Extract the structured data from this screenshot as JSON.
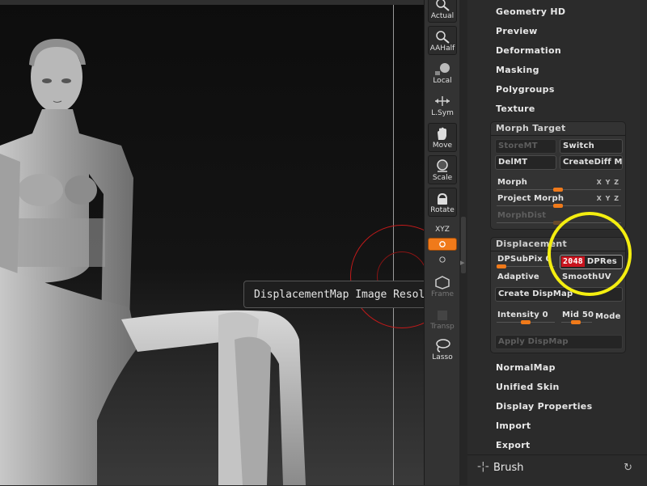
{
  "viewport": {
    "tooltip": "DisplacementMap Image Resolution"
  },
  "tools": [
    {
      "name": "actual",
      "label": "Actual",
      "icon": "magnifier-icon"
    },
    {
      "name": "aahalf",
      "label": "AAHalf",
      "icon": "magnifier-icon"
    },
    {
      "name": "local",
      "label": "Local",
      "icon": "local-icon"
    },
    {
      "name": "lsym",
      "label": "L.Sym",
      "icon": "symmetry-icon"
    },
    {
      "name": "move",
      "label": "Move",
      "icon": "hand-icon"
    },
    {
      "name": "scale",
      "label": "Scale",
      "icon": "scale-icon"
    },
    {
      "name": "rotate",
      "label": "Rotate",
      "icon": "rotate-icon"
    },
    {
      "name": "xyz",
      "label": "XYZ",
      "icon": "xyz-icon"
    },
    {
      "name": "frame",
      "label": "Frame",
      "icon": "frame-icon"
    },
    {
      "name": "transp",
      "label": "Transp",
      "icon": "transp-icon"
    },
    {
      "name": "lasso",
      "label": "Lasso",
      "icon": "lasso-icon"
    }
  ],
  "menu": {
    "geometry_hd": "Geometry HD",
    "preview": "Preview",
    "deformation": "Deformation",
    "masking": "Masking",
    "polygroups": "Polygroups",
    "texture": "Texture",
    "normalmap": "NormalMap",
    "unified_skin": "Unified Skin",
    "display_properties": "Display Properties",
    "import": "Import",
    "export": "Export"
  },
  "morph_target": {
    "title": "Morph Target",
    "storemt": "StoreMT",
    "switch": "Switch",
    "delmt": "DelMT",
    "creatediff": "CreateDiff Mesh",
    "morph": "Morph",
    "project_morph": "Project Morph",
    "morphdist": "MorphDist",
    "sym": "X Y Z"
  },
  "displacement": {
    "title": "Displacement",
    "dpsubpix": "DPSubPix 0",
    "dpres_value": "2048",
    "dpres_label": "DPRes",
    "adaptive": "Adaptive",
    "smoothuv": "SmoothUV",
    "create_dispmap": "Create DispMap",
    "intensity": "Intensity 0",
    "mid": "Mid 50",
    "mode": "Mode",
    "apply_dispmap": "Apply DispMap"
  },
  "footer": {
    "brush": "Brush",
    "cross": "-¦-",
    "reset": "↻"
  },
  "colors": {
    "accent": "#f07a1a",
    "highlight_ring": "#f4ee10",
    "value_badge": "#c8141e"
  }
}
